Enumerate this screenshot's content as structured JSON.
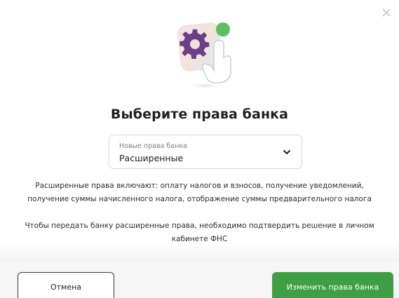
{
  "dialog": {
    "title": "Выберите права банка",
    "close_icon": "close-icon",
    "illustration_icon": "settings-gear-hand-icon"
  },
  "select": {
    "label": "Новые права банка",
    "value": "Расширенные",
    "chevron_icon": "chevron-down-icon"
  },
  "description": {
    "paragraph_1": "Расширенные права включают: оплату налогов и взносов, получение уведомлений, получение суммы начисленного налога, отображение суммы предварительного налога",
    "paragraph_2": "Чтобы передать банку расширенные права, необходимо подтвердить решение в личном кабинете ФНС"
  },
  "buttons": {
    "cancel_label": "Отмена",
    "confirm_label": "Изменить права банка"
  },
  "colors": {
    "accent": "#3f9f45",
    "gear": "#6b3f86",
    "notification_dot": "#5cbf60"
  }
}
